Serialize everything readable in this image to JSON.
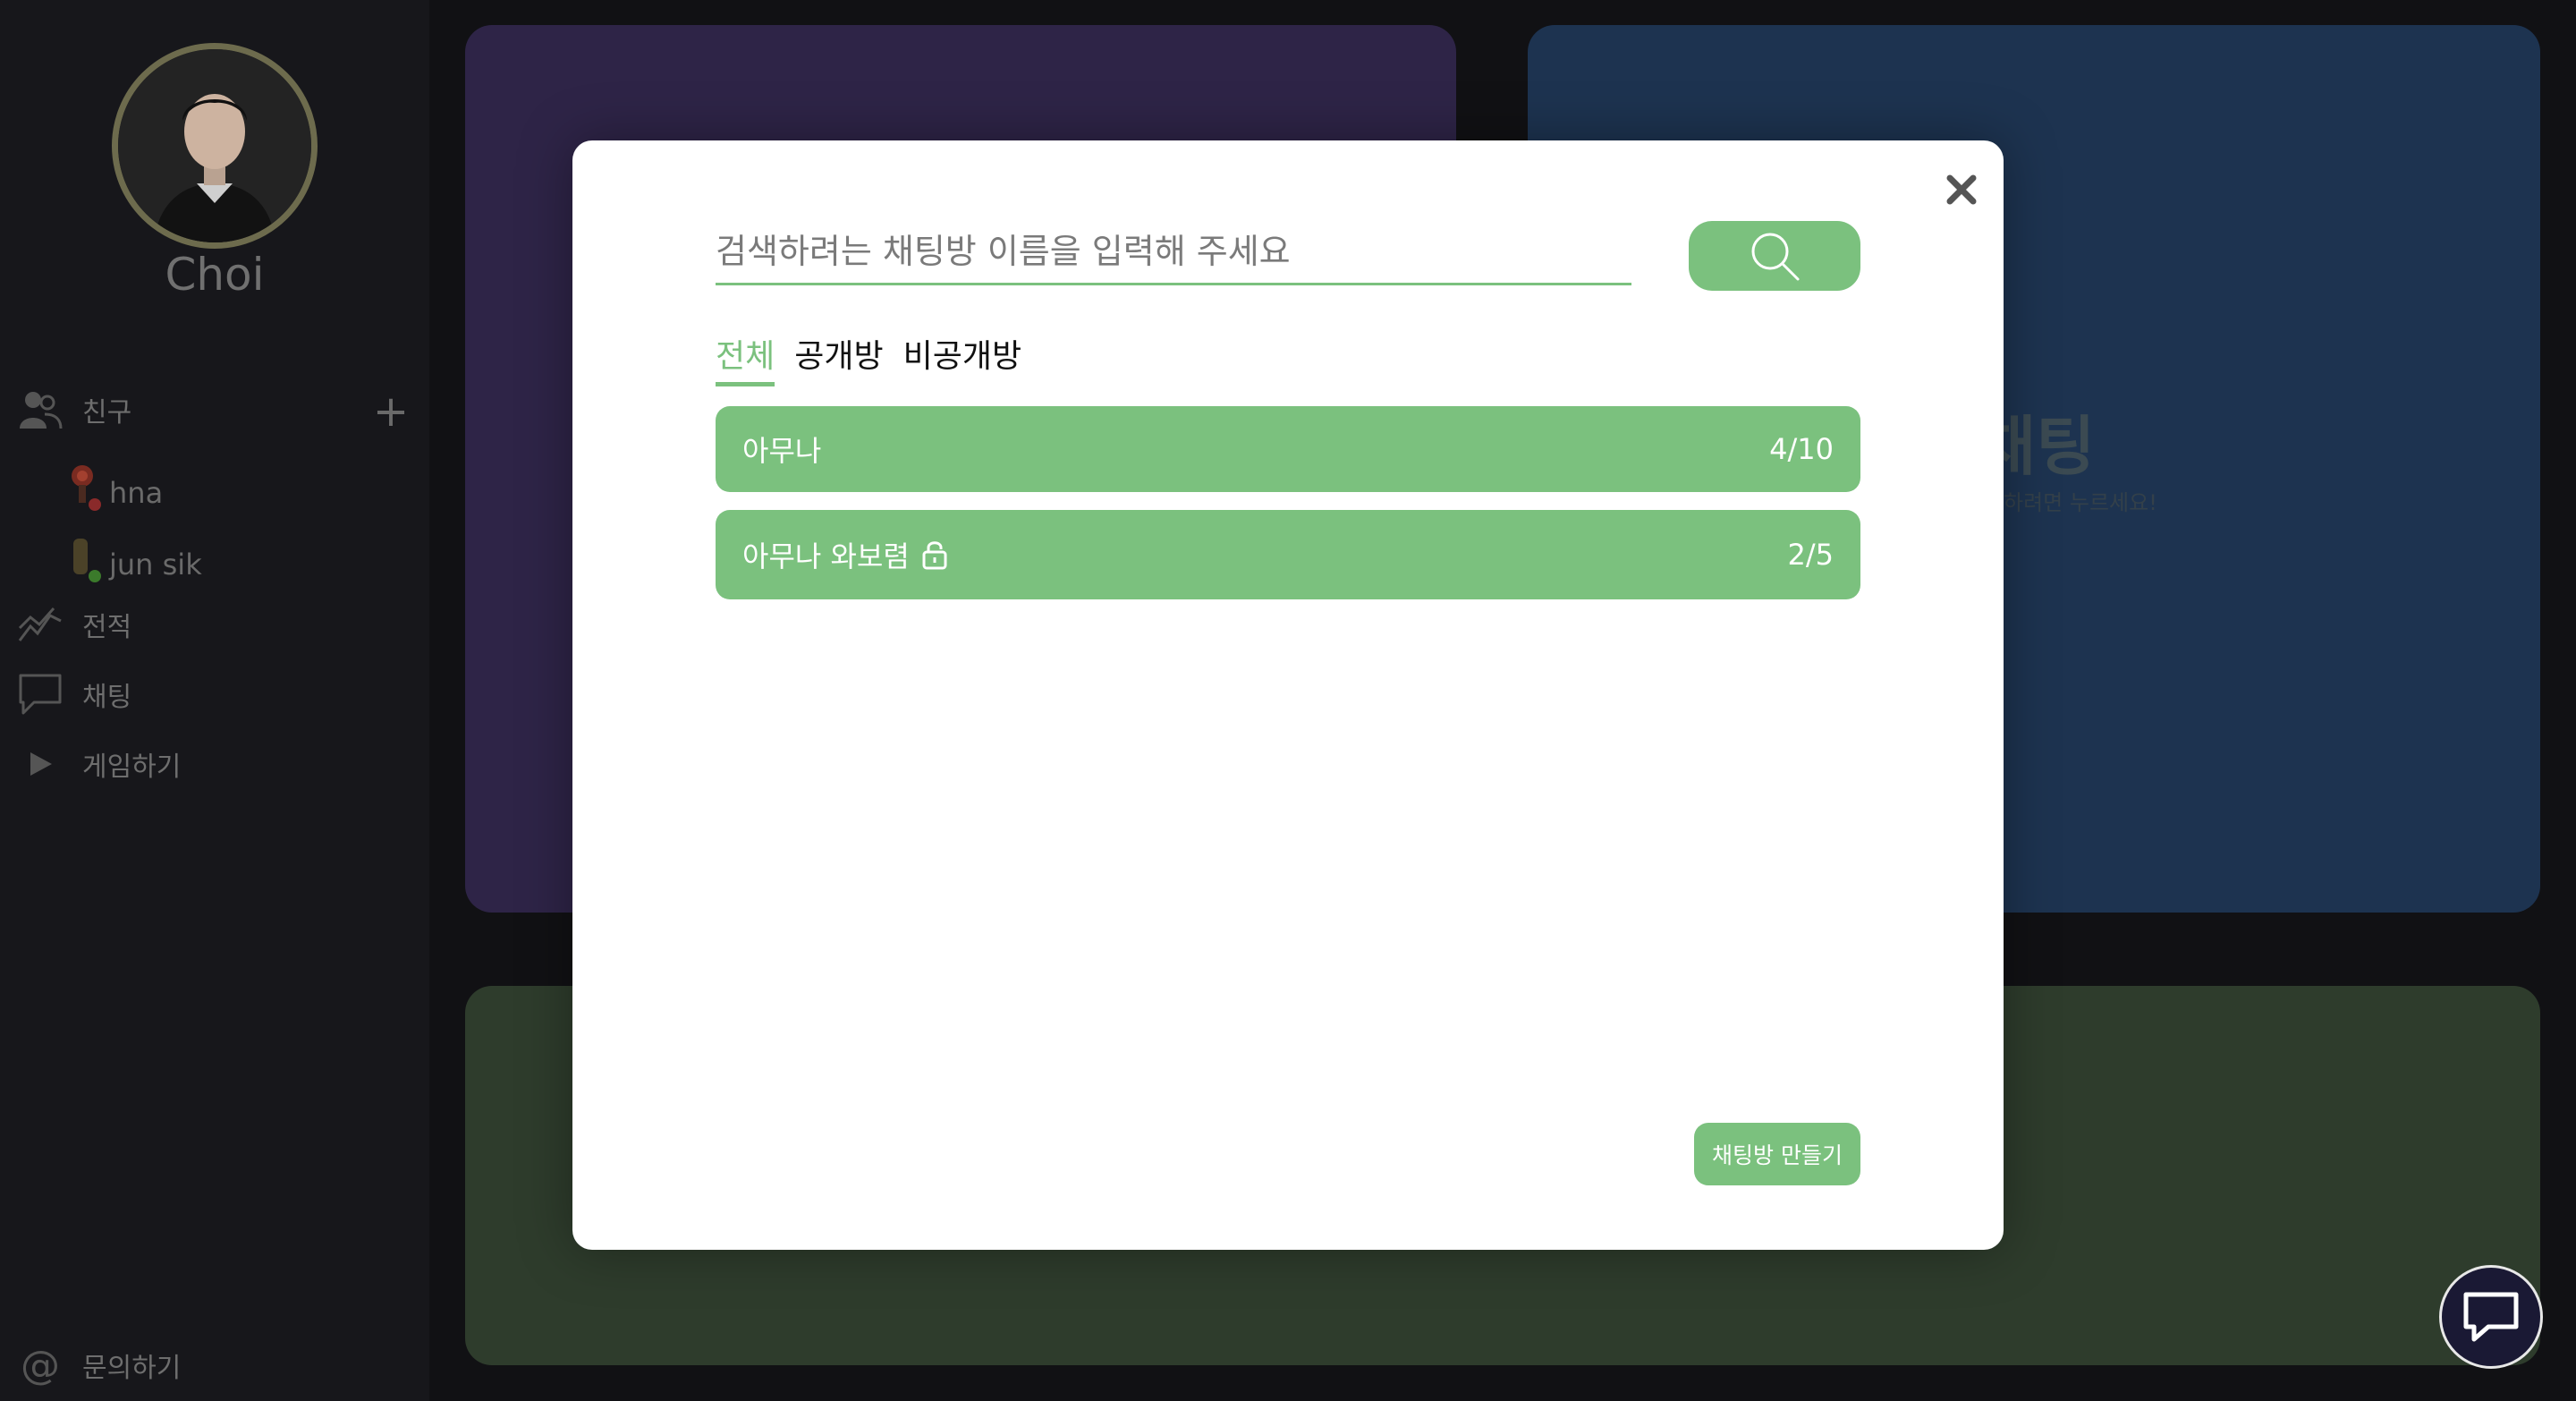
{
  "user": {
    "name": "Choi"
  },
  "sidebar": {
    "friends_label": "친구",
    "add_label": "+",
    "friends": [
      {
        "name": "hna"
      },
      {
        "name": "jun sik"
      }
    ],
    "items": [
      {
        "label": "전적",
        "icon": "chart-line-icon"
      },
      {
        "label": "채팅",
        "icon": "chat-bubble-icon"
      },
      {
        "label": "게임하기",
        "icon": "play-icon"
      }
    ],
    "contact_label": "문의하기"
  },
  "background": {
    "blue_card_title": "채팅",
    "blue_card_subtitle": "하려면 누르세요!"
  },
  "modal": {
    "search_placeholder": "검색하려는 채팅방 이름을 입력해 주세요",
    "tabs": [
      {
        "label": "전체",
        "active": true
      },
      {
        "label": "공개방",
        "active": false
      },
      {
        "label": "비공개방",
        "active": false
      }
    ],
    "rooms": [
      {
        "name": "아무나",
        "count": "4/10",
        "locked": false
      },
      {
        "name": "아무나 와보렴",
        "count": "2/5",
        "locked": true
      }
    ],
    "create_label": "채팅방 만들기"
  },
  "colors": {
    "accent": "#7bc17e",
    "sidebar_bg": "#17171b",
    "card_purple": "#2e2447",
    "card_blue": "#1d3350",
    "card_green": "#2e3c2c"
  }
}
